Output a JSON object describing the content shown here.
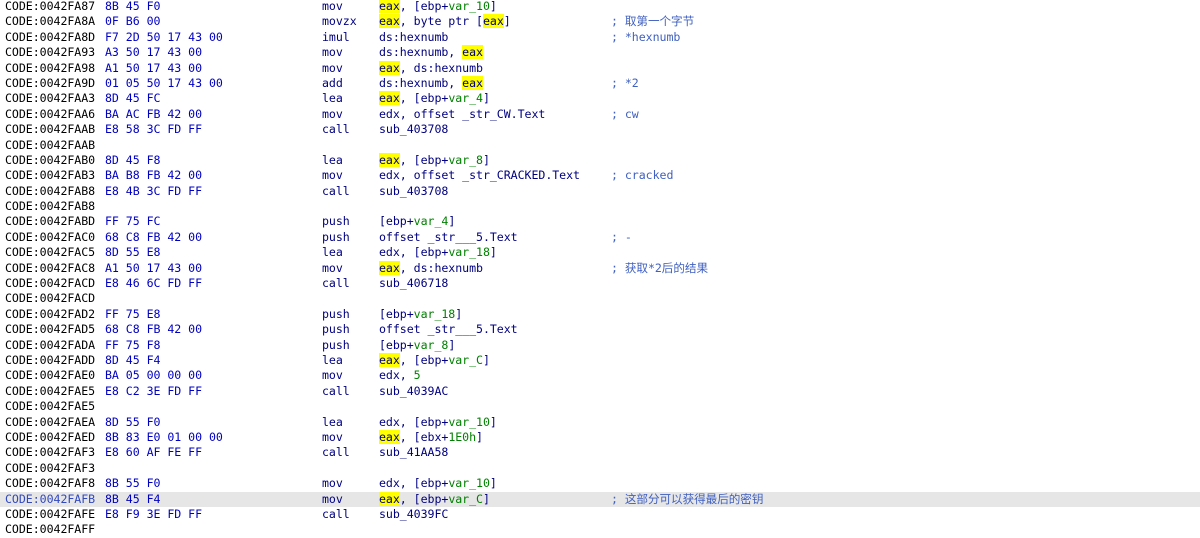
{
  "lines": [
    {
      "addr": "CODE:0042FA87",
      "bytes": "8B 45 F0",
      "mnem": "mov",
      "ops": [
        {
          "t": "eax",
          "c": "hl"
        },
        {
          "t": ", [ebp+"
        },
        {
          "t": "var_10",
          "c": "lv"
        },
        {
          "t": "]"
        }
      ],
      "cmt": ""
    },
    {
      "addr": "CODE:0042FA8A",
      "bytes": "0F B6 00",
      "mnem": "movzx",
      "ops": [
        {
          "t": "eax",
          "c": "hl"
        },
        {
          "t": ", byte ptr ["
        },
        {
          "t": "eax",
          "c": "hl"
        },
        {
          "t": "]"
        }
      ],
      "cmt": "; 取第一个字节"
    },
    {
      "addr": "CODE:0042FA8D",
      "bytes": "F7 2D 50 17 43 00",
      "mnem": "imul",
      "ops": [
        {
          "t": "ds:hexnumb"
        }
      ],
      "cmt": "; *hexnumb"
    },
    {
      "addr": "CODE:0042FA93",
      "bytes": "A3 50 17 43 00",
      "mnem": "mov",
      "ops": [
        {
          "t": "ds:hexnumb, "
        },
        {
          "t": "eax",
          "c": "hl"
        }
      ],
      "cmt": ""
    },
    {
      "addr": "CODE:0042FA98",
      "bytes": "A1 50 17 43 00",
      "mnem": "mov",
      "ops": [
        {
          "t": "eax",
          "c": "hl"
        },
        {
          "t": ", ds:hexnumb"
        }
      ],
      "cmt": ""
    },
    {
      "addr": "CODE:0042FA9D",
      "bytes": "01 05 50 17 43 00",
      "mnem": "add",
      "ops": [
        {
          "t": "ds:hexnumb, "
        },
        {
          "t": "eax",
          "c": "hl"
        }
      ],
      "cmt": "; *2"
    },
    {
      "addr": "CODE:0042FAA3",
      "bytes": "8D 45 FC",
      "mnem": "lea",
      "ops": [
        {
          "t": "eax",
          "c": "hl"
        },
        {
          "t": ", [ebp+"
        },
        {
          "t": "var_4",
          "c": "lv"
        },
        {
          "t": "]"
        }
      ],
      "cmt": ""
    },
    {
      "addr": "CODE:0042FAA6",
      "bytes": "BA AC FB 42 00",
      "mnem": "mov",
      "ops": [
        {
          "t": "edx, offset _str_CW.Text"
        }
      ],
      "cmt": "; cw"
    },
    {
      "addr": "CODE:0042FAAB",
      "bytes": "E8 58 3C FD FF",
      "mnem": "call",
      "ops": [
        {
          "t": "sub_403708"
        }
      ],
      "cmt": ""
    },
    {
      "addr": "CODE:0042FAAB",
      "bytes": "",
      "mnem": "",
      "ops": [],
      "cmt": ""
    },
    {
      "addr": "CODE:0042FAB0",
      "bytes": "8D 45 F8",
      "mnem": "lea",
      "ops": [
        {
          "t": "eax",
          "c": "hl"
        },
        {
          "t": ", [ebp+"
        },
        {
          "t": "var_8",
          "c": "lv"
        },
        {
          "t": "]"
        }
      ],
      "cmt": ""
    },
    {
      "addr": "CODE:0042FAB3",
      "bytes": "BA B8 FB 42 00",
      "mnem": "mov",
      "ops": [
        {
          "t": "edx, offset _str_CRACKED.Text"
        }
      ],
      "cmt": "; cracked"
    },
    {
      "addr": "CODE:0042FAB8",
      "bytes": "E8 4B 3C FD FF",
      "mnem": "call",
      "ops": [
        {
          "t": "sub_403708"
        }
      ],
      "cmt": ""
    },
    {
      "addr": "CODE:0042FAB8",
      "bytes": "",
      "mnem": "",
      "ops": [],
      "cmt": ""
    },
    {
      "addr": "CODE:0042FABD",
      "bytes": "FF 75 FC",
      "mnem": "push",
      "ops": [
        {
          "t": "[ebp+"
        },
        {
          "t": "var_4",
          "c": "lv"
        },
        {
          "t": "]"
        }
      ],
      "cmt": ""
    },
    {
      "addr": "CODE:0042FAC0",
      "bytes": "68 C8 FB 42 00",
      "mnem": "push",
      "ops": [
        {
          "t": "offset _str___5.Text"
        }
      ],
      "cmt": "; -"
    },
    {
      "addr": "CODE:0042FAC5",
      "bytes": "8D 55 E8",
      "mnem": "lea",
      "ops": [
        {
          "t": "edx, [ebp+"
        },
        {
          "t": "var_18",
          "c": "lv"
        },
        {
          "t": "]"
        }
      ],
      "cmt": ""
    },
    {
      "addr": "CODE:0042FAC8",
      "bytes": "A1 50 17 43 00",
      "mnem": "mov",
      "ops": [
        {
          "t": "eax",
          "c": "hl"
        },
        {
          "t": ", ds:hexnumb"
        }
      ],
      "cmt": "; 获取*2后的结果"
    },
    {
      "addr": "CODE:0042FACD",
      "bytes": "E8 46 6C FD FF",
      "mnem": "call",
      "ops": [
        {
          "t": "sub_406718"
        }
      ],
      "cmt": ""
    },
    {
      "addr": "CODE:0042FACD",
      "bytes": "",
      "mnem": "",
      "ops": [],
      "cmt": ""
    },
    {
      "addr": "CODE:0042FAD2",
      "bytes": "FF 75 E8",
      "mnem": "push",
      "ops": [
        {
          "t": "[ebp+"
        },
        {
          "t": "var_18",
          "c": "lv"
        },
        {
          "t": "]"
        }
      ],
      "cmt": ""
    },
    {
      "addr": "CODE:0042FAD5",
      "bytes": "68 C8 FB 42 00",
      "mnem": "push",
      "ops": [
        {
          "t": "offset _str___5.Text"
        }
      ],
      "cmt": ""
    },
    {
      "addr": "CODE:0042FADA",
      "bytes": "FF 75 F8",
      "mnem": "push",
      "ops": [
        {
          "t": "[ebp+"
        },
        {
          "t": "var_8",
          "c": "lv"
        },
        {
          "t": "]"
        }
      ],
      "cmt": ""
    },
    {
      "addr": "CODE:0042FADD",
      "bytes": "8D 45 F4",
      "mnem": "lea",
      "ops": [
        {
          "t": "eax",
          "c": "hl"
        },
        {
          "t": ", [ebp+"
        },
        {
          "t": "var_C",
          "c": "lv"
        },
        {
          "t": "]"
        }
      ],
      "cmt": ""
    },
    {
      "addr": "CODE:0042FAE0",
      "bytes": "BA 05 00 00 00",
      "mnem": "mov",
      "ops": [
        {
          "t": "edx, "
        },
        {
          "t": "5",
          "c": "num"
        }
      ],
      "cmt": ""
    },
    {
      "addr": "CODE:0042FAE5",
      "bytes": "E8 C2 3E FD FF",
      "mnem": "call",
      "ops": [
        {
          "t": "sub_4039AC"
        }
      ],
      "cmt": ""
    },
    {
      "addr": "CODE:0042FAE5",
      "bytes": "",
      "mnem": "",
      "ops": [],
      "cmt": ""
    },
    {
      "addr": "CODE:0042FAEA",
      "bytes": "8D 55 F0",
      "mnem": "lea",
      "ops": [
        {
          "t": "edx, [ebp+"
        },
        {
          "t": "var_10",
          "c": "lv"
        },
        {
          "t": "]"
        }
      ],
      "cmt": ""
    },
    {
      "addr": "CODE:0042FAED",
      "bytes": "8B 83 E0 01 00 00",
      "mnem": "mov",
      "ops": [
        {
          "t": "eax",
          "c": "hl"
        },
        {
          "t": ", [ebx+"
        },
        {
          "t": "1E0h",
          "c": "num"
        },
        {
          "t": "]"
        }
      ],
      "cmt": ""
    },
    {
      "addr": "CODE:0042FAF3",
      "bytes": "E8 60 AF FE FF",
      "mnem": "call",
      "ops": [
        {
          "t": "sub_41AA58"
        }
      ],
      "cmt": ""
    },
    {
      "addr": "CODE:0042FAF3",
      "bytes": "",
      "mnem": "",
      "ops": [],
      "cmt": ""
    },
    {
      "addr": "CODE:0042FAF8",
      "bytes": "8B 55 F0",
      "mnem": "mov",
      "ops": [
        {
          "t": "edx, [ebp+"
        },
        {
          "t": "var_10",
          "c": "lv"
        },
        {
          "t": "]"
        }
      ],
      "cmt": ""
    },
    {
      "addr": "CODE:0042FAFB",
      "bytes": "8B 45 F4",
      "mnem": "mov",
      "ops": [
        {
          "t": "eax",
          "c": "hl"
        },
        {
          "t": ", [ebp+"
        },
        {
          "t": "var_C",
          "c": "lv"
        },
        {
          "t": "]"
        }
      ],
      "cmt": "; 这部分可以获得最后的密钥",
      "selected": true
    },
    {
      "addr": "CODE:0042FAFE",
      "bytes": "E8 F9 3E FD FF",
      "mnem": "call",
      "ops": [
        {
          "t": "sub_4039FC"
        }
      ],
      "cmt": ""
    },
    {
      "addr": "CODE:0042FAFF",
      "bytes": "",
      "mnem": "",
      "ops": [],
      "cmt": ""
    }
  ]
}
